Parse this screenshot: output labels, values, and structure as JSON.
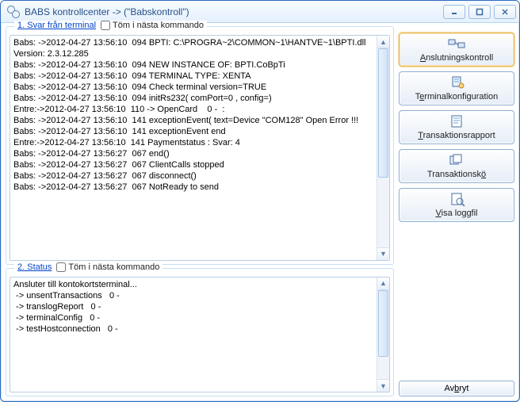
{
  "window": {
    "title": "BABS kontrollcenter   ->  (\"Babskontroll\")"
  },
  "panel1": {
    "legend_link": "1. Svar från terminal",
    "checkbox_label": "Töm i nästa kommando",
    "log": "Babs: ->2012-04-27 13:56:10  094 BPTI: C:\\PROGRA~2\\COMMON~1\\HANTVE~1\\BPTI.dll\nVersion: 2.3.12.285\nBabs: ->2012-04-27 13:56:10  094 NEW INSTANCE OF: BPTI.CoBpTi\nBabs: ->2012-04-27 13:56:10  094 TERMINAL TYPE: XENTA\nBabs: ->2012-04-27 13:56:10  094 Check terminal version=TRUE\nBabs: ->2012-04-27 13:56:10  094 initRs232( comPort=0 , config=)\nEntre:->2012-04-27 13:56:10  110 -> OpenCard    0 -  :\nBabs: ->2012-04-27 13:56:10  141 exceptionEvent( text=Device \"COM128\" Open Error !!!\nBabs: ->2012-04-27 13:56:10  141 exceptionEvent end\nEntre:->2012-04-27 13:56:10  141 Paymentstatus : Svar: 4\nBabs: ->2012-04-27 13:56:27  067 end()\nBabs: ->2012-04-27 13:56:27  067 ClientCalls stopped\nBabs: ->2012-04-27 13:56:27  067 disconnect()\nBabs: ->2012-04-27 13:56:27  067 NotReady to send"
  },
  "panel2": {
    "legend_link": "2. Status",
    "checkbox_label": "Töm i nästa kommando",
    "log": "Ansluter till kontokortsterminal...\n -> unsentTransactions   0 -\n -> translogReport   0 -\n -> terminalConfig   0 -\n -> testHostconnection   0 -"
  },
  "buttons": {
    "b1": {
      "pre": "",
      "u": "A",
      "post": "nslutningskontroll"
    },
    "b2": {
      "pre": "T",
      "u": "e",
      "post": "rminalkonfiguration"
    },
    "b3": {
      "pre": "",
      "u": "T",
      "post": "ransaktionsrapport"
    },
    "b4": {
      "pre": "Transaktionsk",
      "u": "ö",
      "post": ""
    },
    "b5": {
      "pre": "",
      "u": "V",
      "post": "isa loggfil"
    },
    "cancel": {
      "pre": "Av",
      "u": "b",
      "post": "ryt"
    }
  }
}
